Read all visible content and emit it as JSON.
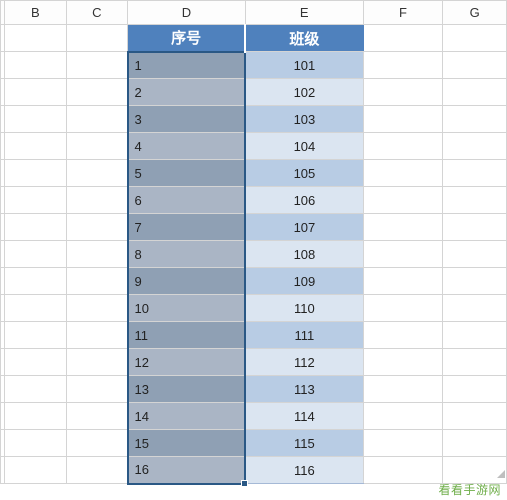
{
  "columns": {
    "B": "B",
    "C": "C",
    "D": "D",
    "E": "E",
    "F": "F",
    "G": "G"
  },
  "headers": {
    "D": "序号",
    "E": "班级"
  },
  "rows": [
    {
      "seq": "1",
      "class": "101"
    },
    {
      "seq": "2",
      "class": "102"
    },
    {
      "seq": "3",
      "class": "103"
    },
    {
      "seq": "4",
      "class": "104"
    },
    {
      "seq": "5",
      "class": "105"
    },
    {
      "seq": "6",
      "class": "106"
    },
    {
      "seq": "7",
      "class": "107"
    },
    {
      "seq": "8",
      "class": "108"
    },
    {
      "seq": "9",
      "class": "109"
    },
    {
      "seq": "10",
      "class": "110"
    },
    {
      "seq": "11",
      "class": "111"
    },
    {
      "seq": "12",
      "class": "112"
    },
    {
      "seq": "13",
      "class": "113"
    },
    {
      "seq": "14",
      "class": "114"
    },
    {
      "seq": "15",
      "class": "115"
    },
    {
      "seq": "16",
      "class": "116"
    }
  ],
  "watermark": "看看手游网",
  "selection": {
    "column": "D",
    "from_row_index": 0,
    "to_row_index": 15
  }
}
